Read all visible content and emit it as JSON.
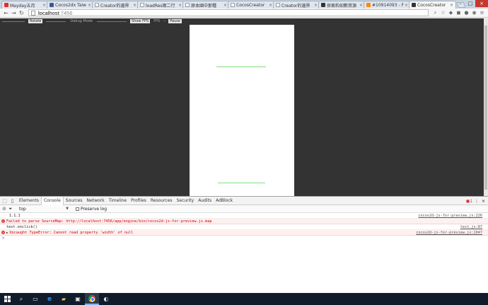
{
  "browser": {
    "tabs": [
      {
        "label": "Mayday五月",
        "fav_color": "#e52d27"
      },
      {
        "label": "Cocos2dx Taiw",
        "fav_color": "#3b5998"
      },
      {
        "label": "Creator的邊界",
        "fav_color": "#ffffff"
      },
      {
        "label": "loadRes兩二行",
        "fav_color": "#ffffff"
      },
      {
        "label": "原本國中那種",
        "fav_color": "#ffffff"
      },
      {
        "label": "CocosCreator",
        "fav_color": "#ffffff"
      },
      {
        "label": "Creator的邊界",
        "fav_color": "#ffffff"
      },
      {
        "label": "探索和如數資源",
        "fav_color": "#333333"
      },
      {
        "label": "#10914093 - F",
        "fav_color": "#ff8a00"
      },
      {
        "label": "CocosCreator",
        "fav_color": "#333333",
        "active": true
      }
    ],
    "url_host": "localhost",
    "url_port": ":7456"
  },
  "cocos_toolbar": {
    "rotate": "Rotate",
    "debug_mode": "Debug Mode",
    "show_fps": "Show FPS",
    "fps": "FPS",
    "pause": "Pause"
  },
  "devtools": {
    "tabs": [
      "Elements",
      "Console",
      "Sources",
      "Network",
      "Timeline",
      "Profiles",
      "Resources",
      "Security",
      "Audits",
      "AdBlock"
    ],
    "active_tab": "Console",
    "error_count": "1",
    "context": "top",
    "preserve_log": "Preserve log",
    "console": [
      {
        "type": "log",
        "text": "1.1.1",
        "source": "cocos2d-js-for-preview.js:226"
      },
      {
        "type": "error",
        "text": "Failed to parse SourceMap: http://localhost:7456/app/engine/bin/cocos2d-js-for-preview.js.map",
        "source": ""
      },
      {
        "type": "log",
        "text": "test.onclick()",
        "source": "test.js:87"
      },
      {
        "type": "error",
        "text": "Uncaught TypeError: Cannot read property 'width' of null",
        "source": "cocos2d-js-for-preview.js:1047"
      }
    ],
    "prompt": ">"
  },
  "taskbar": {
    "items": [
      "start-icon",
      "search-icon",
      "task-view-icon",
      "edge-icon",
      "file-explorer-icon",
      "store-icon",
      "chrome-icon",
      "app-icon"
    ]
  }
}
